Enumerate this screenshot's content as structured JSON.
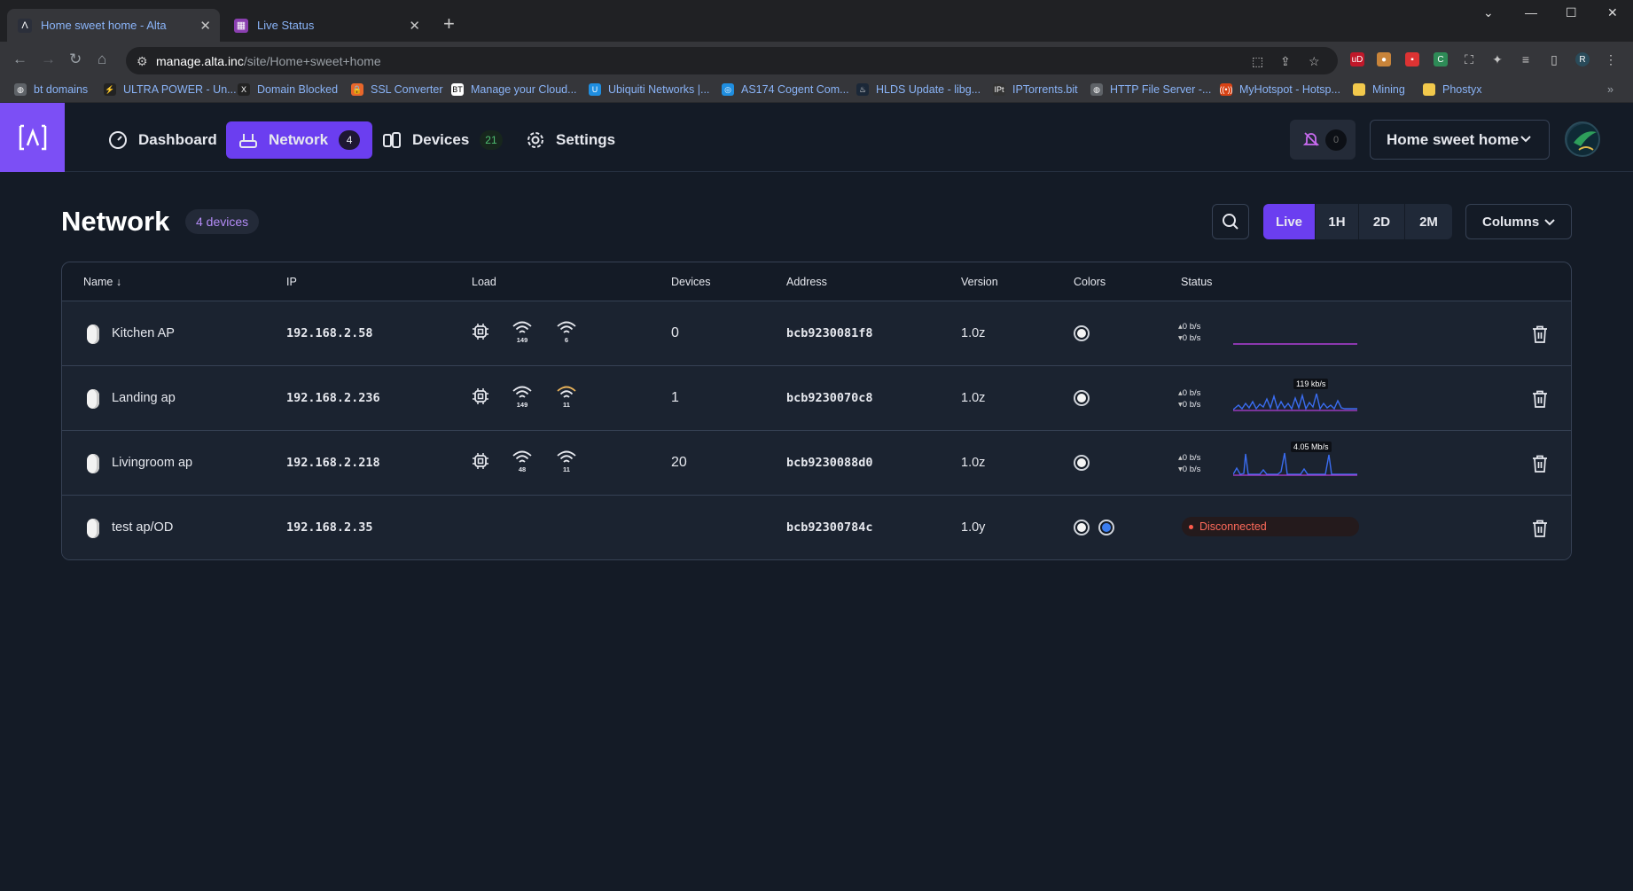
{
  "browser": {
    "tabs": [
      {
        "title": "Home sweet home - Alta",
        "active": true
      },
      {
        "title": "Live Status",
        "active": false
      }
    ],
    "url_host": "manage.alta.inc",
    "url_path": "/site/Home+sweet+home",
    "bookmarks": [
      "bt domains",
      "ULTRA POWER - Un...",
      "Domain Blocked",
      "SSL Converter",
      "Manage your Cloud...",
      "Ubiquiti Networks |...",
      "AS174 Cogent Com...",
      "HLDS Update - libg...",
      "IPTorrents.bit",
      "HTTP File Server -...",
      "MyHotspot - Hotsp...",
      "Mining",
      "Phostyx"
    ]
  },
  "app": {
    "nav": {
      "dashboard": "Dashboard",
      "network": "Network",
      "network_count": "4",
      "devices": "Devices",
      "devices_count": "21",
      "settings": "Settings"
    },
    "notifications_count": "0",
    "site_name": "Home sweet home"
  },
  "page": {
    "title": "Network",
    "badge": "4 devices",
    "ranges": [
      "Live",
      "1H",
      "2D",
      "2M"
    ],
    "active_range": "Live",
    "columns_button": "Columns"
  },
  "table": {
    "headers": {
      "name": "Name",
      "ip": "IP",
      "load": "Load",
      "devices": "Devices",
      "address": "Address",
      "version": "Version",
      "colors": "Colors",
      "status": "Status"
    },
    "rows": [
      {
        "name": "Kitchen AP",
        "ip": "192.168.2.58",
        "radio24": "149",
        "radio5": "6",
        "devices": "0",
        "address": "bcb9230081f8",
        "version": "1.0z",
        "up": "0 b/s",
        "down": "0 b/s",
        "peak": ""
      },
      {
        "name": "Landing ap",
        "ip": "192.168.2.236",
        "radio24": "149",
        "radio5": "11",
        "devices": "1",
        "address": "bcb9230070c8",
        "version": "1.0z",
        "up": "0 b/s",
        "down": "0 b/s",
        "peak": "119 kb/s"
      },
      {
        "name": "Livingroom ap",
        "ip": "192.168.2.218",
        "radio24": "48",
        "radio5": "11",
        "devices": "20",
        "address": "bcb9230088d0",
        "version": "1.0z",
        "up": "0 b/s",
        "down": "0 b/s",
        "peak": "4.05 Mb/s"
      },
      {
        "name": "test ap/OD",
        "ip": "192.168.2.35",
        "devices": "",
        "address": "bcb92300784c",
        "version": "1.0y",
        "status": "Disconnected"
      }
    ]
  },
  "colors": {
    "accent": "#6b3ef0",
    "logo": "#7c4ff5",
    "background": "#141b26",
    "row": "#1b2330",
    "disconnected": "#ff6b5b",
    "radio_warn": "#e8b25a",
    "spark_blue": "#3a6cf0",
    "spark_purple": "#b23fd8"
  }
}
